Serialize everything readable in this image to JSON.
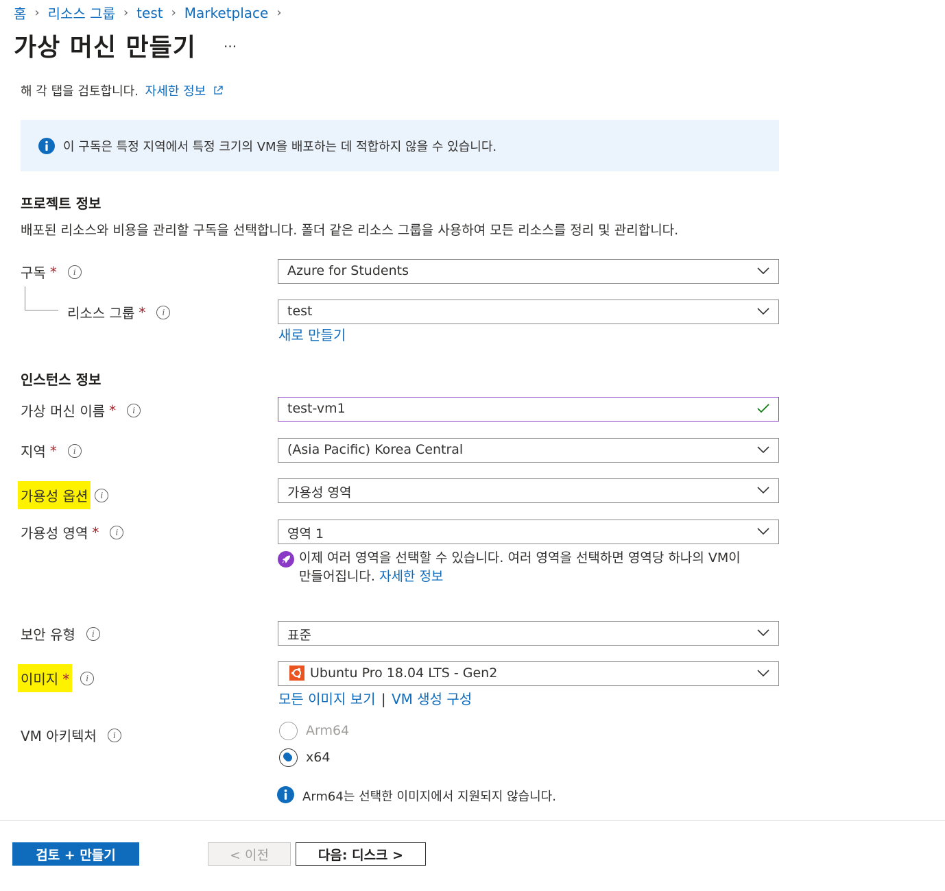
{
  "breadcrumb": [
    "홈",
    "리소스 그룹",
    "test",
    "Marketplace"
  ],
  "page_title": "가상 머신 만들기",
  "more_label": "...",
  "intro": {
    "text": "해 각 탭을 검토합니다.",
    "link": "자세한 정보"
  },
  "banner": {
    "text": "이 구독은 특정 지역에서 특정 크기의 VM을 배포하는 데 적합하지 않을 수 있습니다."
  },
  "project": {
    "title": "프로젝트 정보",
    "desc": "배포된 리소스와 비용을 관리할 구독을 선택합니다. 폴더 같은 리소스 그룹을 사용하여 모든 리소스를 정리 및 관리합니다.",
    "subscription": {
      "label": "구독",
      "value": "Azure for Students"
    },
    "resource_group": {
      "label": "리소스 그룹",
      "value": "test",
      "create_new": "새로 만들기"
    }
  },
  "instance": {
    "title": "인스턴스 정보",
    "vm_name": {
      "label": "가상 머신 이름",
      "value": "test-vm1"
    },
    "region": {
      "label": "지역",
      "value": "(Asia Pacific) Korea Central"
    },
    "availability_option": {
      "label": "가용성 옵션",
      "value": "가용성 영역"
    },
    "availability_zone": {
      "label": "가용성 영역",
      "value": "영역 1",
      "note_line1": "이제 여러 영역을 선택할 수 있습니다. 여러 영역을 선택하면 영역당 하나의 VM이",
      "note_line2": "만들어집니다.",
      "note_link": "자세한 정보"
    },
    "security_type": {
      "label": "보안 유형",
      "value": "표준"
    },
    "image": {
      "label": "이미지",
      "value": "Ubuntu Pro 18.04 LTS - Gen2",
      "see_all": "모든 이미지 보기",
      "separator": "|",
      "configure": "VM 생성 구성"
    },
    "architecture": {
      "label": "VM 아키텍처",
      "options": [
        "Arm64",
        "x64"
      ],
      "selected": "x64",
      "note": "Arm64는 선택한 이미지에서 지원되지 않습니다."
    }
  },
  "required_mark": "*",
  "footer": {
    "review_create": "검토 + 만들기",
    "previous": "< 이전",
    "next": "다음: 디스크 >"
  },
  "colors": {
    "accent": "#0f6cbd",
    "highlight": "#fff200",
    "banner_bg": "#ebf3fc",
    "required": "#a4262c",
    "valid": "#107c10"
  }
}
